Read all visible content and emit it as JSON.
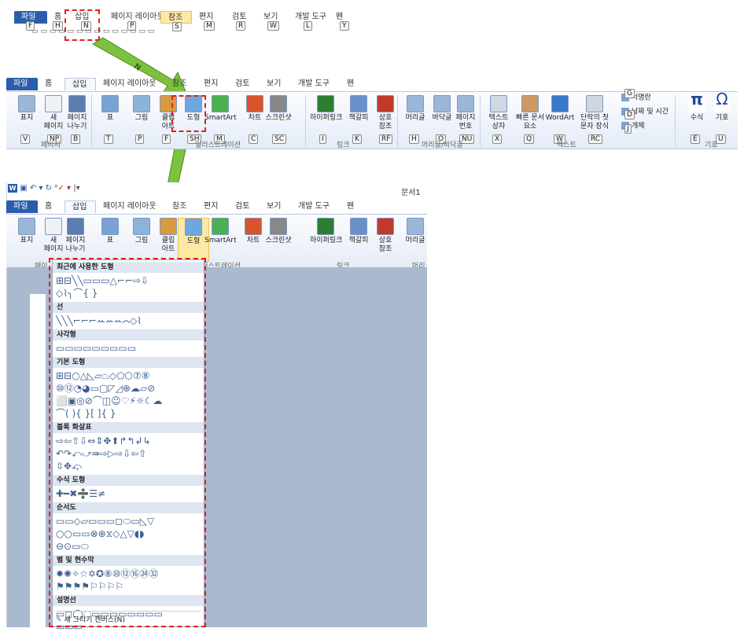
{
  "tab_row1": [
    {
      "label": "파일",
      "key": "F",
      "type": "file"
    },
    {
      "label": "홈",
      "key": "H"
    },
    {
      "label": "삽입",
      "key": "N"
    },
    {
      "label": "페이지 레이아웃",
      "key": "P"
    },
    {
      "label": "참조",
      "key": "S",
      "type": "hl"
    },
    {
      "label": "편지",
      "key": "M"
    },
    {
      "label": "검토",
      "key": "R"
    },
    {
      "label": "보기",
      "key": "W"
    },
    {
      "label": "개발 도구",
      "key": "L"
    },
    {
      "label": "펜",
      "key": "Y"
    }
  ],
  "arrow_labels": {
    "first": "N",
    "second": "SH"
  },
  "tab_row2": [
    "파일",
    "홈",
    "삽입",
    "페이지 레이아웃",
    "참조",
    "편지",
    "검토",
    "보기",
    "개발 도구",
    "펜"
  ],
  "ribbon_buttons": [
    {
      "label": "표지",
      "key": "V",
      "icon": "cover-page-icon"
    },
    {
      "label": "새\n페이지",
      "key": "NP",
      "icon": "blank-page-icon"
    },
    {
      "label": "페이지\n나누기",
      "key": "B",
      "icon": "page-break-icon"
    },
    {
      "label": "표",
      "key": "T",
      "icon": "table-icon"
    },
    {
      "label": "그림",
      "key": "P",
      "icon": "picture-icon"
    },
    {
      "label": "클립\n아트",
      "key": "F",
      "icon": "clip-art-icon"
    },
    {
      "label": "도형",
      "key": "SH",
      "icon": "shapes-icon"
    },
    {
      "label": "SmartArt",
      "key": "M",
      "icon": "smartart-icon"
    },
    {
      "label": "차트",
      "key": "C",
      "icon": "chart-icon"
    },
    {
      "label": "스크린샷",
      "key": "SC",
      "icon": "screenshot-icon"
    },
    {
      "label": "하이퍼링크",
      "key": "I",
      "icon": "hyperlink-icon"
    },
    {
      "label": "책갈피",
      "key": "K",
      "icon": "bookmark-icon"
    },
    {
      "label": "상호\n참조",
      "key": "RF",
      "icon": "cross-reference-icon"
    },
    {
      "label": "머리글",
      "key": "H",
      "icon": "header-icon"
    },
    {
      "label": "바닥글",
      "key": "O",
      "icon": "footer-icon"
    },
    {
      "label": "페이지\n번호",
      "key": "NU",
      "icon": "page-number-icon"
    },
    {
      "label": "텍스트\n상자",
      "key": "X",
      "icon": "text-box-icon"
    },
    {
      "label": "빠른 문서\n요소",
      "key": "Q",
      "icon": "quick-parts-icon"
    },
    {
      "label": "WordArt",
      "key": "W",
      "icon": "wordart-icon"
    },
    {
      "label": "단락의 첫\n문자 장식",
      "key": "RC",
      "icon": "drop-cap-icon"
    },
    {
      "label": "수식",
      "key": "E",
      "icon": "equation-icon"
    },
    {
      "label": "기호",
      "key": "U",
      "icon": "symbol-icon"
    }
  ],
  "ribbon_small": [
    {
      "label": "서명란",
      "key": "G"
    },
    {
      "label": "날짜 및 시간",
      "key": "D"
    },
    {
      "label": "개체",
      "key": "J"
    }
  ],
  "ribbon_groups": [
    "페이지",
    "일러스트레이션",
    "링크",
    "머리글/바닥글",
    "텍스트",
    "기호"
  ],
  "window": {
    "title": "문서1"
  },
  "lower_buttons": [
    "표지",
    "새\n페이지",
    "페이지\n나누기",
    "표",
    "그림",
    "클립\n아트",
    "도형",
    "SmartArt",
    "차트",
    "스크린샷",
    "하이퍼링크",
    "책갈피",
    "상호\n참조",
    "머리글"
  ],
  "lower_groups": [
    "페이",
    "일러스트레이션",
    "링크",
    "머리"
  ],
  "gallery": {
    "sections": [
      {
        "title": "최근에 사용한 도형",
        "rows": [
          "⊞⊟╲╲▭▭▭△⌐⌐⇨⇩",
          "◇⌇╮⌒{ }"
        ]
      },
      {
        "title": "선",
        "rows": [
          "╲╲╲⌐⌐⌐ꕀꕀꕀ⌒◇⌇"
        ]
      },
      {
        "title": "사각형",
        "rows": [
          "▭▭▭▭▭▭▭▭▭"
        ]
      },
      {
        "title": "기본 도형",
        "rows": [
          "⊞⊟○△◺▱⏢◇⬠⬡⑦⑧",
          "⑩⑫◔◕▭▢◸◿⊕☁▱⊘",
          "⬜▣◎⊘⌒◫☺♡⚡☼☾☁",
          "⌒( ){ }[ ]{ }"
        ]
      },
      {
        "title": "블록 화살표",
        "rows": [
          "⇨⇦⇧⇩⇔⇕✥⬆↱↰↲↳",
          "↶↷⤺⤻⇛⇨▷⇨⇩⇦⇧",
          "⇳✥⤽"
        ]
      },
      {
        "title": "수식 도형",
        "rows": [
          "✚━✖➗☰≠"
        ]
      },
      {
        "title": "순서도",
        "rows": [
          "▭▭◇▱▭▭▭◻⬭▭◺▽",
          "○○▭▭⊗⊕⧖◇△▽◖◗",
          "⊖⊙▭⬭"
        ]
      },
      {
        "title": "별 및 현수막",
        "rows": [
          "✹✺✧☆✡✪⑧⑩⑫⑯㉔㉜",
          "⚑⚑⚑⚑⚐⚐⚐⚐"
        ]
      },
      {
        "title": "설명선",
        "rows": [
          "▭◻◯◌▭▭▭▭▭▭▭▭",
          "▭▭▭"
        ]
      }
    ],
    "footer": "새 그리기 캔버스(N)"
  }
}
